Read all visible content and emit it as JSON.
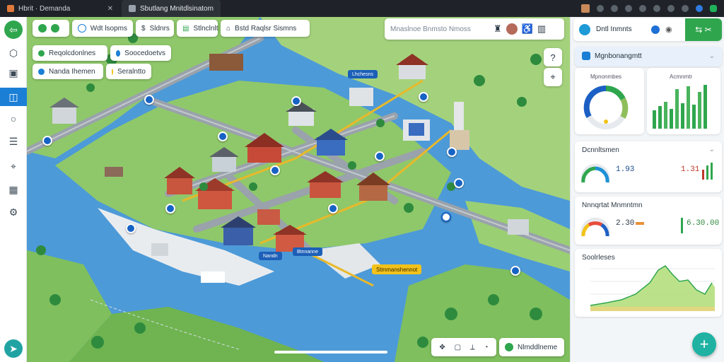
{
  "browser": {
    "tab1_title": "Hbrit · Demanda",
    "tab2_title": "Sbutlang Mnitdlsinatom"
  },
  "colors": {
    "accent": "#2fa64e",
    "primary": "#1b7fd6",
    "water": "#4d9ad8",
    "land": "#8fc86a",
    "road": "#9aa2ab",
    "route": "#e8b92a"
  },
  "map": {
    "filters": [
      "Wdt lsopms",
      "Sldnrs",
      "Stlnclnlt",
      "Bstd Raqlsr Sismns"
    ],
    "layers": [
      "Reqolcdonlnes",
      "Soocedoetvs",
      "Nanda Ihemen",
      "Seralntto"
    ],
    "search_placeholder": "Mnaslnoe Bnmsto Nmoss",
    "tags": {
      "north": "Lhchesns",
      "center": "Btnnanne",
      "south": "Nandn",
      "station": "Stmmanshennot"
    },
    "bottom_status": "Nlmddlneme"
  },
  "panel": {
    "header_title": "Dntl Inmnts",
    "section_title": "Mgnbonangmtt",
    "card1_label_left": "Mpnonmbes",
    "card1_label_right": "Acmnmtr",
    "card2_title": "Dcnnltsmen",
    "card2_value": "1.93",
    "card2_value_right": "1.31",
    "card3_title": "Nnnqrtat Mnmntmn",
    "card3_value": "2.30",
    "card3_value_right": "6.30.00",
    "card4_title": "Soolrleses"
  }
}
